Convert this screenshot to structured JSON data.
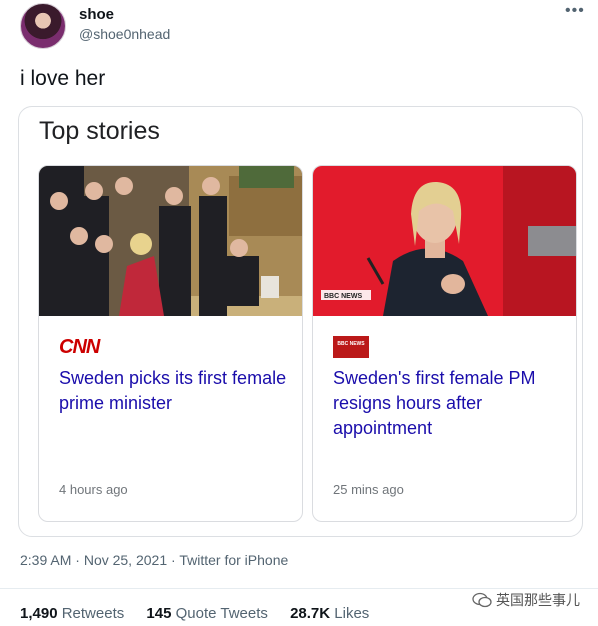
{
  "author": {
    "name": "shoe",
    "handle": "@shoe0nhead"
  },
  "more_label": "•••",
  "tweet": {
    "text": "i love her"
  },
  "card": {
    "title": "Top stories",
    "stories": [
      {
        "source": "CNN",
        "headline": "Sweden picks its first female prime minister",
        "age": "4 hours ago"
      },
      {
        "source": "BBC NEWS",
        "headline": "Sweden's first female PM resigns hours after appointment",
        "age": "25 mins ago"
      }
    ]
  },
  "meta": {
    "time": "2:39 AM",
    "date": "Nov 25, 2021",
    "client": "Twitter for iPhone"
  },
  "stats": {
    "retweets_count": "1,490",
    "retweets_label": "Retweets",
    "quotes_count": "145",
    "quotes_label": "Quote Tweets",
    "likes_count": "28.7K",
    "likes_label": "Likes"
  },
  "watermark": {
    "text": "英国那些事儿"
  }
}
